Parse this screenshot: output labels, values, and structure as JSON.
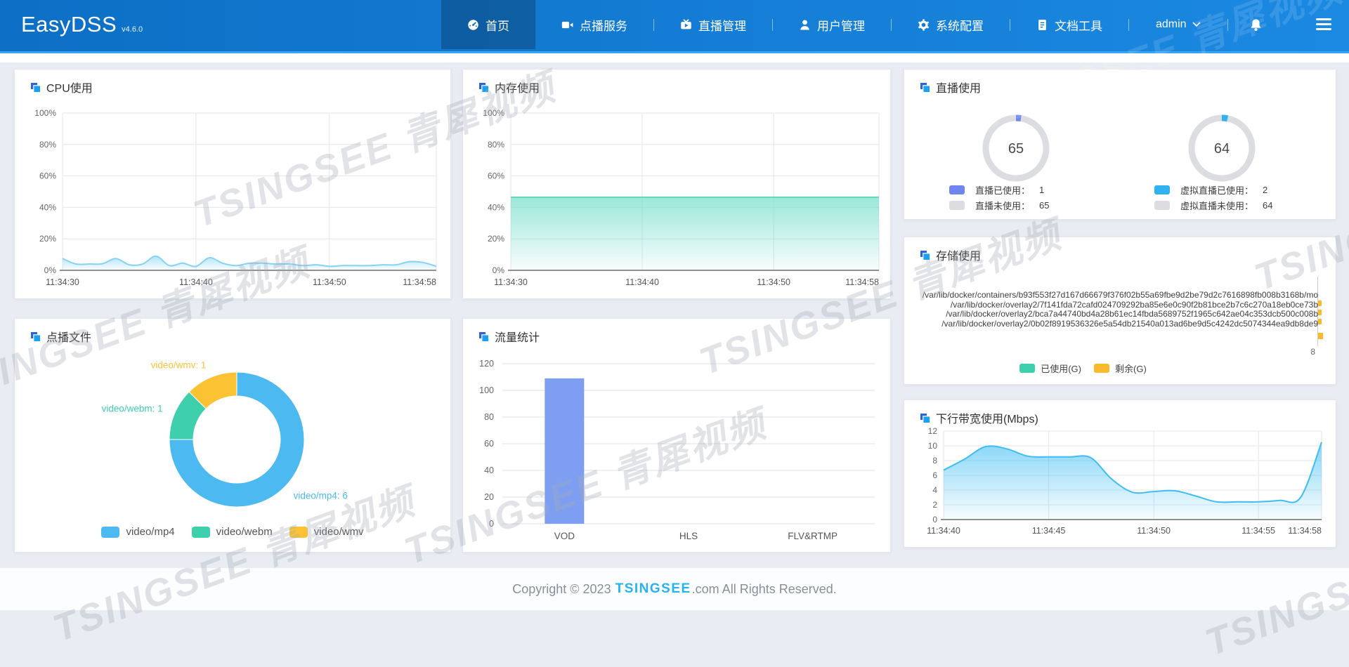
{
  "navbar": {
    "brand": "EasyDSS",
    "version": "v4.6.0",
    "items": [
      {
        "label": "首页"
      },
      {
        "label": "点播服务"
      },
      {
        "label": "直播管理"
      },
      {
        "label": "用户管理"
      },
      {
        "label": "系统配置"
      },
      {
        "label": "文档工具"
      }
    ],
    "user": "admin"
  },
  "watermark": "TSINGSEE 青犀视频",
  "footer": {
    "prefix": "Copyright © 2023 ",
    "brand": "TSINGSEE",
    "suffix": ".com All Rights Reserved."
  },
  "chart_data": [
    {
      "id": "cpu",
      "type": "area",
      "title": "CPU使用",
      "ylim": [
        0,
        100
      ],
      "y_ticks": [
        "100%",
        "80%",
        "60%",
        "40%",
        "20%",
        "0%"
      ],
      "x_ticks": [
        "11:34:30",
        "11:34:40",
        "11:34:50",
        "11:34:58"
      ],
      "x_tick_pos": [
        0,
        0.357,
        0.714,
        1
      ],
      "color": "#86d2f5",
      "values": [
        7.5,
        4,
        4,
        4.2,
        7.5,
        3.5,
        4,
        9,
        3,
        4.5,
        2.5,
        8,
        4.5,
        3,
        4.5,
        4.5,
        4,
        4,
        3,
        3.5,
        2.5,
        3,
        3,
        3,
        3.5,
        3.5,
        5.5,
        5,
        2.5
      ]
    },
    {
      "id": "memory",
      "type": "area",
      "title": "内存使用",
      "ylim": [
        0,
        100
      ],
      "y_ticks": [
        "100%",
        "80%",
        "60%",
        "40%",
        "20%",
        "0%"
      ],
      "x_ticks": [
        "11:34:30",
        "11:34:40",
        "11:34:50",
        "11:34:58"
      ],
      "x_tick_pos": [
        0,
        0.357,
        0.714,
        1
      ],
      "color": "#5fd8c2",
      "values": [
        46.5,
        46.5,
        46.5,
        46.5,
        46.5,
        46.5,
        46.5,
        46.5,
        46.5,
        46.5,
        46.5,
        46.5,
        46.5,
        46.5,
        46.5,
        46.5,
        46.5,
        46.5,
        46.5,
        46.5,
        46.5,
        46.5,
        46.5,
        46.5,
        46.5,
        46.5,
        46.5,
        46.5,
        46.5
      ]
    },
    {
      "id": "live",
      "type": "gauge",
      "title": "直播使用",
      "track_color": "#dcdde1",
      "gauges": [
        {
          "value": "65",
          "used": 1,
          "total": 66,
          "color": "#7086ee",
          "legend": [
            {
              "label": "直播已使用：",
              "count": "1"
            },
            {
              "label": "直播未使用：",
              "count": "65"
            }
          ]
        },
        {
          "value": "64",
          "used": 2,
          "total": 66,
          "color": "#2fb2f1",
          "legend": [
            {
              "label": "虚拟直播已使用：",
              "count": "2"
            },
            {
              "label": "虚拟直播未使用：",
              "count": "64"
            }
          ]
        }
      ]
    },
    {
      "id": "storage",
      "type": "hbar",
      "title": "存储使用",
      "categories": [
        "/var/lib/docker/containers/b93f553f27d167d66679f376f02b55a69fbe9d2be79d2c7616898fb008b3168b/mo",
        "/var/lib/docker/overlay2/7f141fda72cafd024709292ba85e6e0c90f2b81bce2b7c6c270a18eb0ce73b",
        "/var/lib/docker/overlay2/bca7a44740bd4a28b61ec14fbda5689752f1965c642ae04c353dcb500c008b",
        "/var/lib/docker/overlay2/0b02f8919536326e5a54db21540a013ad6be9d5c4242dc5074344ea9db8de9"
      ],
      "legend": [
        {
          "label": "已使用(G)",
          "color": "#3ed0ae"
        },
        {
          "label": "剩余(G)",
          "color": "#fbba2c"
        }
      ],
      "partial_tick": "8"
    },
    {
      "id": "vod",
      "type": "pie",
      "title": "点播文件",
      "slices": [
        {
          "label": "video/mp4",
          "value": 6,
          "color": "#4cb9f1"
        },
        {
          "label": "video/webm",
          "value": 1,
          "color": "#3ed0ad"
        },
        {
          "label": "video/wmv",
          "value": 1,
          "color": "#fbc334"
        }
      ]
    },
    {
      "id": "traffic",
      "type": "bar",
      "title": "流量统计",
      "categories": [
        "VOD",
        "HLS",
        "FLV&RTMP"
      ],
      "values": [
        109,
        0,
        0
      ],
      "ylim": [
        0,
        120
      ],
      "y_ticks": [
        "120",
        "100",
        "80",
        "60",
        "40",
        "20",
        "0"
      ],
      "color": "#7e9ff1"
    },
    {
      "id": "bandwidth",
      "type": "area",
      "title": "下行带宽使用(Mbps)",
      "ylim": [
        0,
        12
      ],
      "y_ticks": [
        "12",
        "10",
        "8",
        "6",
        "4",
        "2",
        "0"
      ],
      "x_ticks": [
        "11:34:40",
        "11:34:45",
        "11:34:50",
        "11:34:55",
        "11:34:58"
      ],
      "x_tick_pos": [
        0,
        0.278,
        0.556,
        0.833,
        1
      ],
      "color": "#3fbdf3",
      "values": [
        6.7,
        8.2,
        9.9,
        9.6,
        8.6,
        8.5,
        8.5,
        8.4,
        5.5,
        3.7,
        3.8,
        3.9,
        3.2,
        2.4,
        2.4,
        2.4,
        2.6,
        3.0,
        10.5
      ]
    }
  ]
}
